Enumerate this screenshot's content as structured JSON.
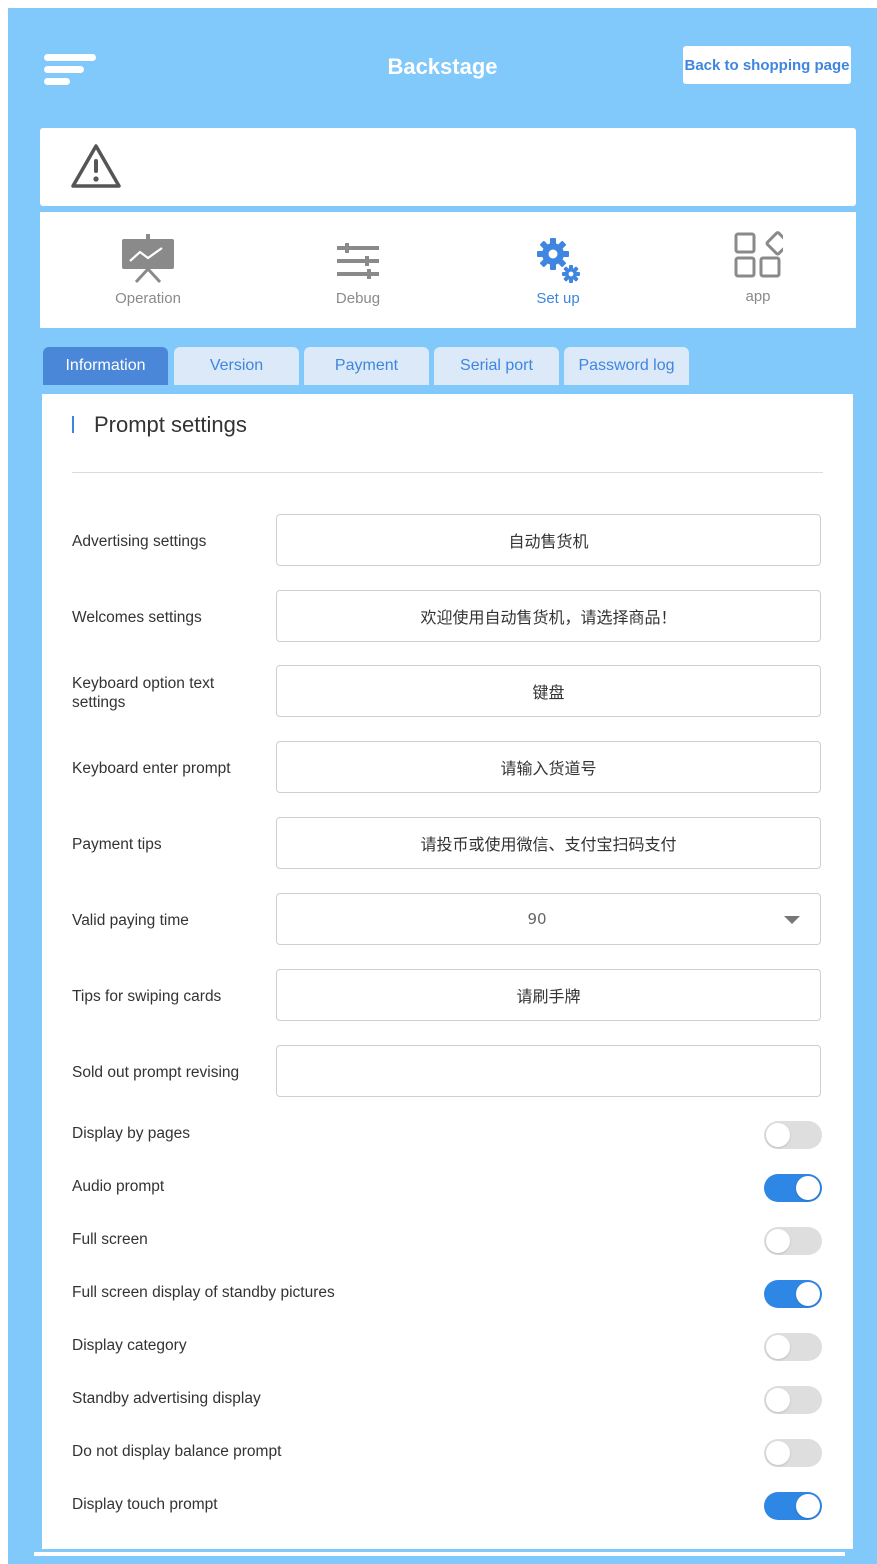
{
  "header": {
    "title": "Backstage",
    "back_button": "Back to shopping page",
    "menu_icon": "hamburger-menu-icon"
  },
  "alert": {
    "icon": "warning-triangle-icon"
  },
  "nav": {
    "items": [
      {
        "label": "Operation",
        "icon": "presentation-chart-icon",
        "active": false
      },
      {
        "label": "Debug",
        "icon": "sliders-icon",
        "active": false
      },
      {
        "label": "Set up",
        "icon": "gears-icon",
        "active": true
      },
      {
        "label": "app",
        "icon": "apps-grid-icon",
        "active": false
      }
    ]
  },
  "tabs": [
    {
      "label": "Information",
      "active": true
    },
    {
      "label": "Version",
      "active": false
    },
    {
      "label": "Payment",
      "active": false
    },
    {
      "label": "Serial port",
      "active": false
    },
    {
      "label": "Password log",
      "active": false
    }
  ],
  "section": {
    "title": "Prompt settings"
  },
  "fields": [
    {
      "label": "Advertising settings",
      "value": "自动售货机"
    },
    {
      "label": "Welcomes settings",
      "value": "欢迎使用自动售货机，请选择商品！"
    },
    {
      "label": "Keyboard option text settings",
      "value": "键盘"
    },
    {
      "label": "Keyboard enter prompt",
      "value": "请输入货道号"
    },
    {
      "label": "Payment tips",
      "value": "请投币或使用微信、支付宝扫码支付"
    },
    {
      "label": "Valid paying time",
      "value": "90"
    },
    {
      "label": "Tips for swiping cards",
      "value": "请刷手牌"
    },
    {
      "label": "Sold out prompt revising",
      "value": ""
    }
  ],
  "toggles": [
    {
      "label": "Display by pages",
      "on": false
    },
    {
      "label": "Audio prompt",
      "on": true
    },
    {
      "label": "Full screen",
      "on": false
    },
    {
      "label": "Full screen display of standby pictures",
      "on": true
    },
    {
      "label": "Display category",
      "on": false
    },
    {
      "label": "Standby advertising display",
      "on": false
    },
    {
      "label": "Do not display balance prompt",
      "on": false
    },
    {
      "label": "Display touch prompt",
      "on": true
    }
  ],
  "colors": {
    "background": "#81c9fb",
    "accent": "#3f86e0",
    "toggle_on": "#2e86e5",
    "toggle_off": "#dedede"
  }
}
